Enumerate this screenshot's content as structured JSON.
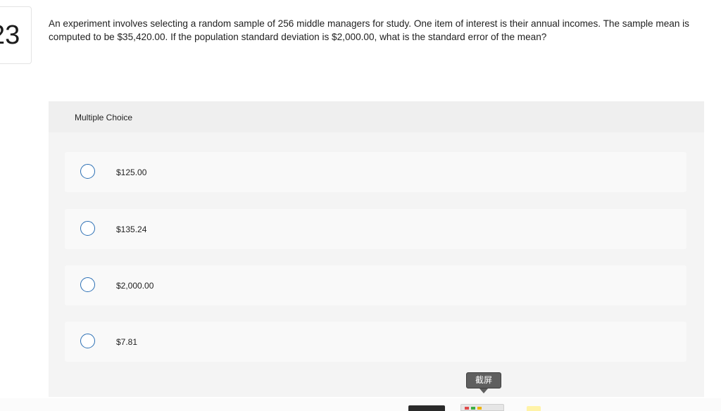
{
  "question": {
    "number": "23",
    "text": "An experiment involves selecting a random sample of 256 middle managers for study. One item of interest is their annual incomes. The sample mean is computed to be $35,420.00. If the population standard deviation is $2,000.00, what is the standard error of the mean?"
  },
  "multiple_choice": {
    "heading": "Multiple Choice",
    "options": [
      {
        "label": "$125.00",
        "selected": false
      },
      {
        "label": "$135.24",
        "selected": false
      },
      {
        "label": "$2,000.00",
        "selected": false
      },
      {
        "label": "$7.81",
        "selected": false
      }
    ]
  },
  "overlay": {
    "screenshot_tooltip": "截屏"
  },
  "colors": {
    "radio_border": "#2b6fb4",
    "panel_background": "#f4f4f4",
    "choice_background": "#f9f9f9",
    "tooltip_background": "#5f5f5f"
  },
  "icons": {
    "radio": "radio-button-unselected-icon"
  }
}
